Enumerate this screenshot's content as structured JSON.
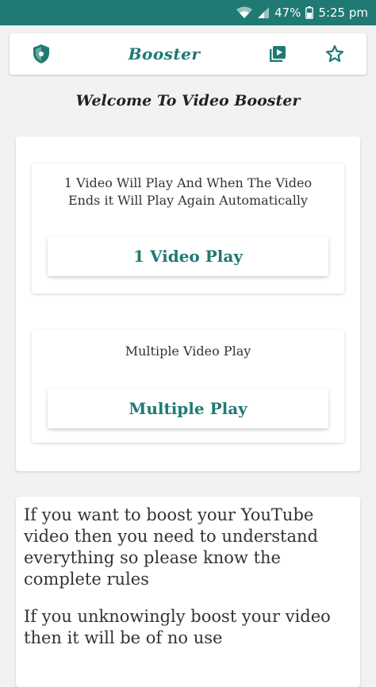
{
  "status_bar": {
    "battery": "47%",
    "time": "5:25 pm"
  },
  "toolbar": {
    "title": "Booster",
    "left_icon": "shield-icon",
    "right_icons": [
      "playlist-icon",
      "star-icon"
    ]
  },
  "welcome": "Welcome To Video Booster",
  "single_play": {
    "description": "1 Video Will Play And When The Video Ends it Will Play Again Automatically",
    "button_label": "1 Video Play"
  },
  "multiple_play": {
    "description": "Multiple Video Play",
    "button_label": "Multiple Play"
  },
  "info": {
    "paragraph_1": "If you want to boost your YouTube video then you need to understand everything so please know the complete rules",
    "paragraph_2": "If you unknowingly boost your video then it will be of no use"
  },
  "colors": {
    "accent": "#1f7a73",
    "background": "#f2f2f2"
  }
}
